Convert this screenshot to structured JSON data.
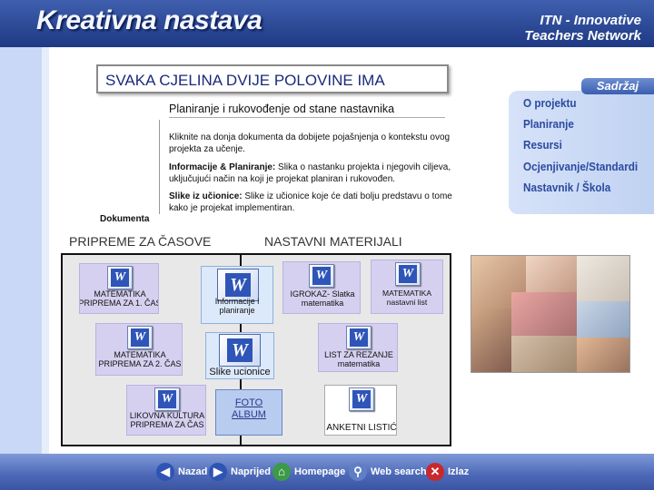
{
  "header": {
    "logo": "Kreativna nastava",
    "brand_line1": "ITN - Innovative",
    "brand_line2": "Teachers Network"
  },
  "sidebar": {
    "tab_label": "Sadržaj",
    "items": [
      {
        "label": "O projektu"
      },
      {
        "label": "Planiranje"
      },
      {
        "label": "Resursi"
      },
      {
        "label": "Ocjenjivanje/Standardi"
      },
      {
        "label": "Nastavnik / Škola"
      }
    ]
  },
  "main": {
    "title": "SVAKA CJELINA DVIJE POLOVINE IMA",
    "subtitle": "Planiranje i rukovođenje od stane nastavnika",
    "intro": "Kliknite na donja dokumenta da dobijete pojašnjenja o kontekstu ovog projekta za učenje.",
    "info_bold": "Informacije & Planiranje:",
    "info_text": " Slika o nastanku projekta i njegovih ciljeva, uključujući način na koji je projekat planiran i rukovođen.",
    "slike_bold": "Slike iz učionice:",
    "slike_text": " Slike iz učionice koje će dati bolju predstavu o tome kako je projekat implementiran.",
    "dokumenta_label": "Dokumenta"
  },
  "documents": {
    "left_header": "PRIPREME ZA ČASOVE",
    "right_header": "NASTAVNI  MATERIJALI",
    "items": [
      {
        "label": "MATEMATIKA\nPRIPREMA ZA 1. ČAS"
      },
      {
        "label": "MATEMATIKA\nPRIPREMA ZA 2. ČAS"
      },
      {
        "label": "LIKOVNA KULTURA\nPRIPREMA ZA ČAS"
      },
      {
        "label": "Informacije i\nplaniranje"
      },
      {
        "label": "Slike ucionice"
      },
      {
        "label": "IGROKAZ-  Slatka\nmatematika"
      },
      {
        "label": "MATEMATIKA\nnastavni list"
      },
      {
        "label": "LIST ZA REZANJE\nmatematika"
      },
      {
        "label": "ANKETNI LISTIĆ"
      }
    ],
    "foto_album": "FOTO\nALBUM"
  },
  "footer": {
    "buttons": [
      {
        "label": "Nazad",
        "icon": "arrow-left-icon"
      },
      {
        "label": "Naprijed",
        "icon": "arrow-right-icon"
      },
      {
        "label": "Homepage",
        "icon": "home-icon"
      },
      {
        "label": "Web search",
        "icon": "magnifier-icon"
      },
      {
        "label": "Izlaz",
        "icon": "close-icon"
      }
    ]
  },
  "colors": {
    "header_blue": "#2d4a96",
    "sidebar_text": "#2b4aa0",
    "doc_lavender": "#d6d0f0",
    "exit_red": "#c8282c",
    "nav_green": "#3d9a48"
  }
}
